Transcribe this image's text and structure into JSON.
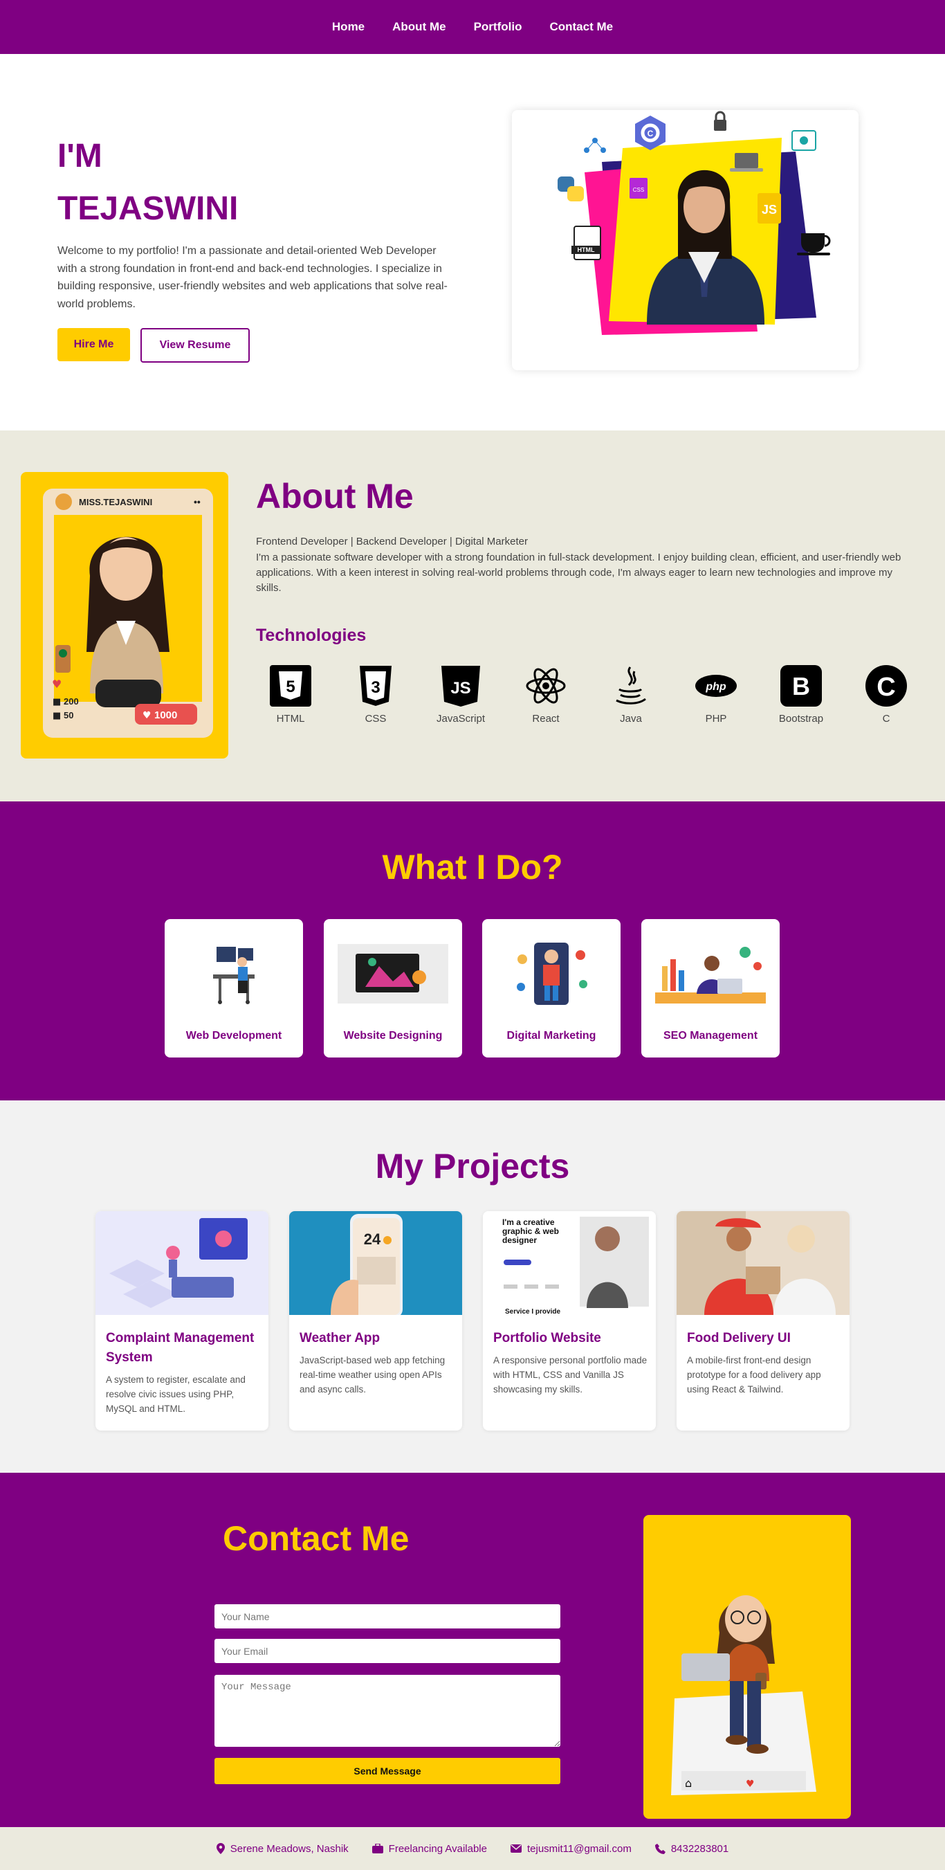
{
  "nav": {
    "items": [
      "Home",
      "About Me",
      "Portfolio",
      "Contact Me"
    ]
  },
  "hero": {
    "title_line1": "I'M",
    "title_line2": "TEJASWINI",
    "description": "Welcome to my portfolio! I'm a passionate and detail-oriented Web Developer with a strong foundation in front-end and back-end technologies. I specialize in building responsive, user-friendly websites and web applications that solve real-world problems.",
    "hire_label": "Hire Me",
    "resume_label": "View Resume",
    "collage_labels": {
      "css": "CSS",
      "html": "HTML",
      "js": "JS",
      "c": "C"
    }
  },
  "about": {
    "title": "About Me",
    "subtitle": "Frontend Developer | Backend Developer | Digital Marketer",
    "text": "I'm a passionate software developer with a strong foundation in full-stack development. I enjoy building clean, efficient, and user-friendly web applications. With a keen interest in solving real-world problems through code, I'm always eager to learn new technologies and improve my skills.",
    "photo": {
      "username": "MISS.TEJASWINI",
      "likes": "1000",
      "stat1": "200",
      "stat2": "50"
    },
    "technologies_title": "Technologies",
    "technologies": [
      "HTML",
      "CSS",
      "JavaScript",
      "React",
      "Java",
      "PHP",
      "Bootstrap",
      "C"
    ],
    "tech_icon_text": {
      "html": "5",
      "css": "3",
      "js": "JS",
      "php": "php",
      "bootstrap": "B",
      "c": "C"
    }
  },
  "services": {
    "title": "What I Do?",
    "items": [
      "Web Development",
      "Website Designing",
      "Digital Marketing",
      "SEO Management"
    ]
  },
  "projects": {
    "title": "My Projects",
    "items": [
      {
        "title": "Complaint Management System",
        "desc": "A system to register, escalate and resolve civic issues using PHP, MySQL and HTML."
      },
      {
        "title": "Weather App",
        "desc": "JavaScript-based web app fetching real-time weather using open APIs and async calls."
      },
      {
        "title": "Portfolio Website",
        "desc": "A responsive personal portfolio made with HTML, CSS and Vanilla JS showcasing my skills."
      },
      {
        "title": "Food Delivery UI",
        "desc": "A mobile-first front-end design prototype for a food delivery app using React & Tailwind."
      }
    ],
    "thumb_text": {
      "weather_temp": "24",
      "portfolio_headline": "I'm a creative graphic & web designer",
      "portfolio_caption": "Service I provide"
    }
  },
  "contact": {
    "title": "Contact Me",
    "name_placeholder": "Your Name",
    "email_placeholder": "Your Email",
    "message_placeholder": "Your Message",
    "send_label": "Send Message"
  },
  "footer": {
    "location": "Serene Meadows, Nashik",
    "status": "Freelancing Available",
    "email": "tejusmit11@gmail.com",
    "phone": "8432283801"
  },
  "colors": {
    "purple": "#7f0082",
    "yellow": "#ffcc00",
    "beige": "#ebeade",
    "light_gray": "#f2f2f2"
  }
}
